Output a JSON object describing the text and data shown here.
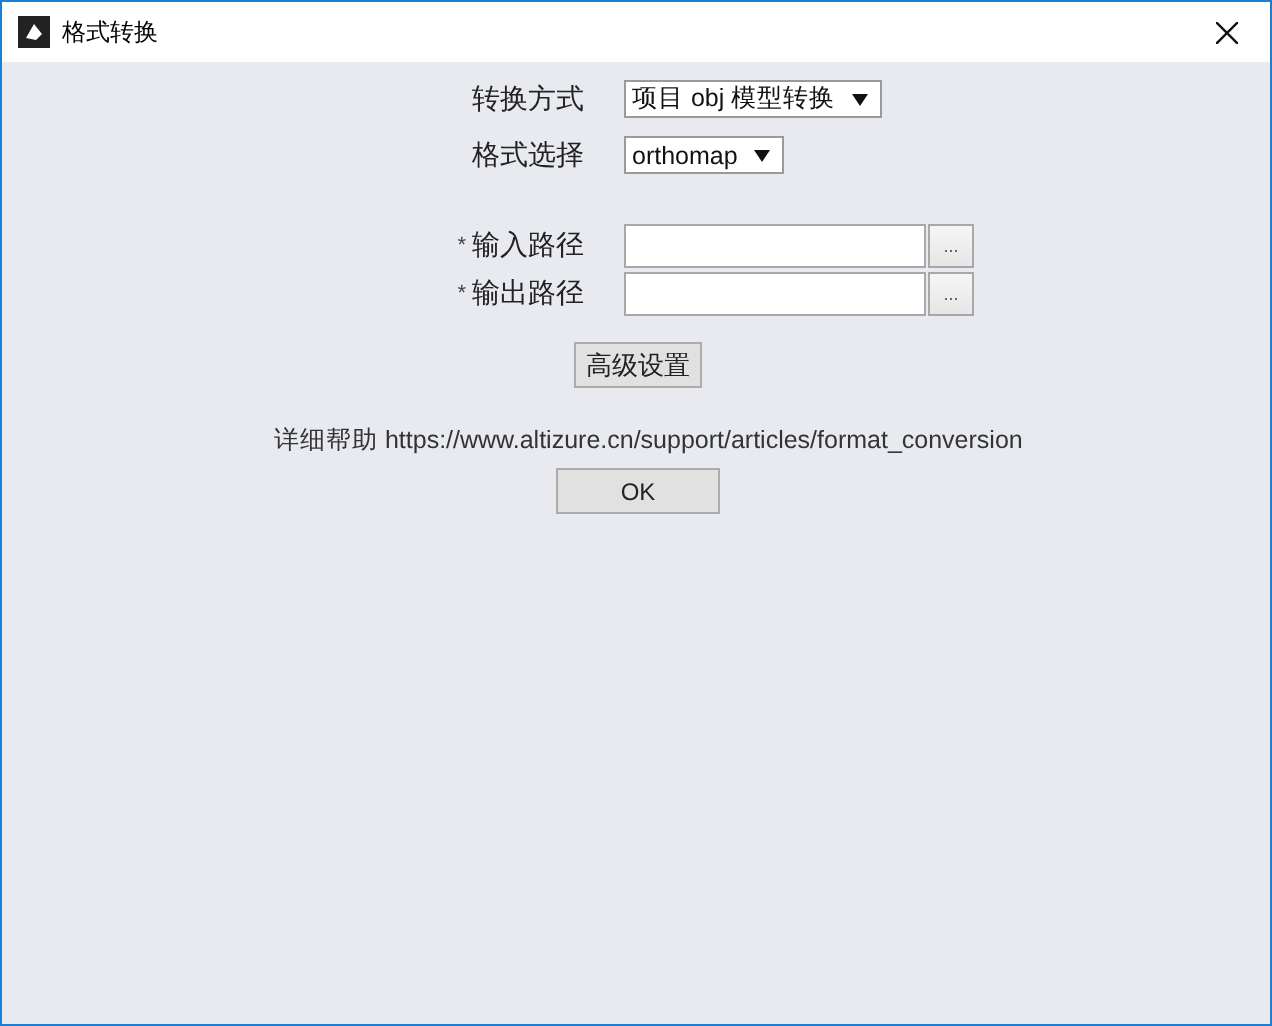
{
  "window": {
    "title": "格式转换"
  },
  "fields": [
    {
      "kind": "select",
      "label": "转换方式",
      "value": "项目 obj 模型转换"
    },
    {
      "kind": "select",
      "label": "格式选择",
      "value": "orthomap"
    },
    {
      "kind": "path",
      "marker": "*",
      "label": "输入路径",
      "browse": "..."
    },
    {
      "kind": "path",
      "marker": "*",
      "label": "输出路径",
      "browse": "..."
    }
  ],
  "advanced_button": "高级设置",
  "help": "详细帮助 https://www.altizure.cn/support/articles/format_conversion",
  "ok_button": "OK"
}
